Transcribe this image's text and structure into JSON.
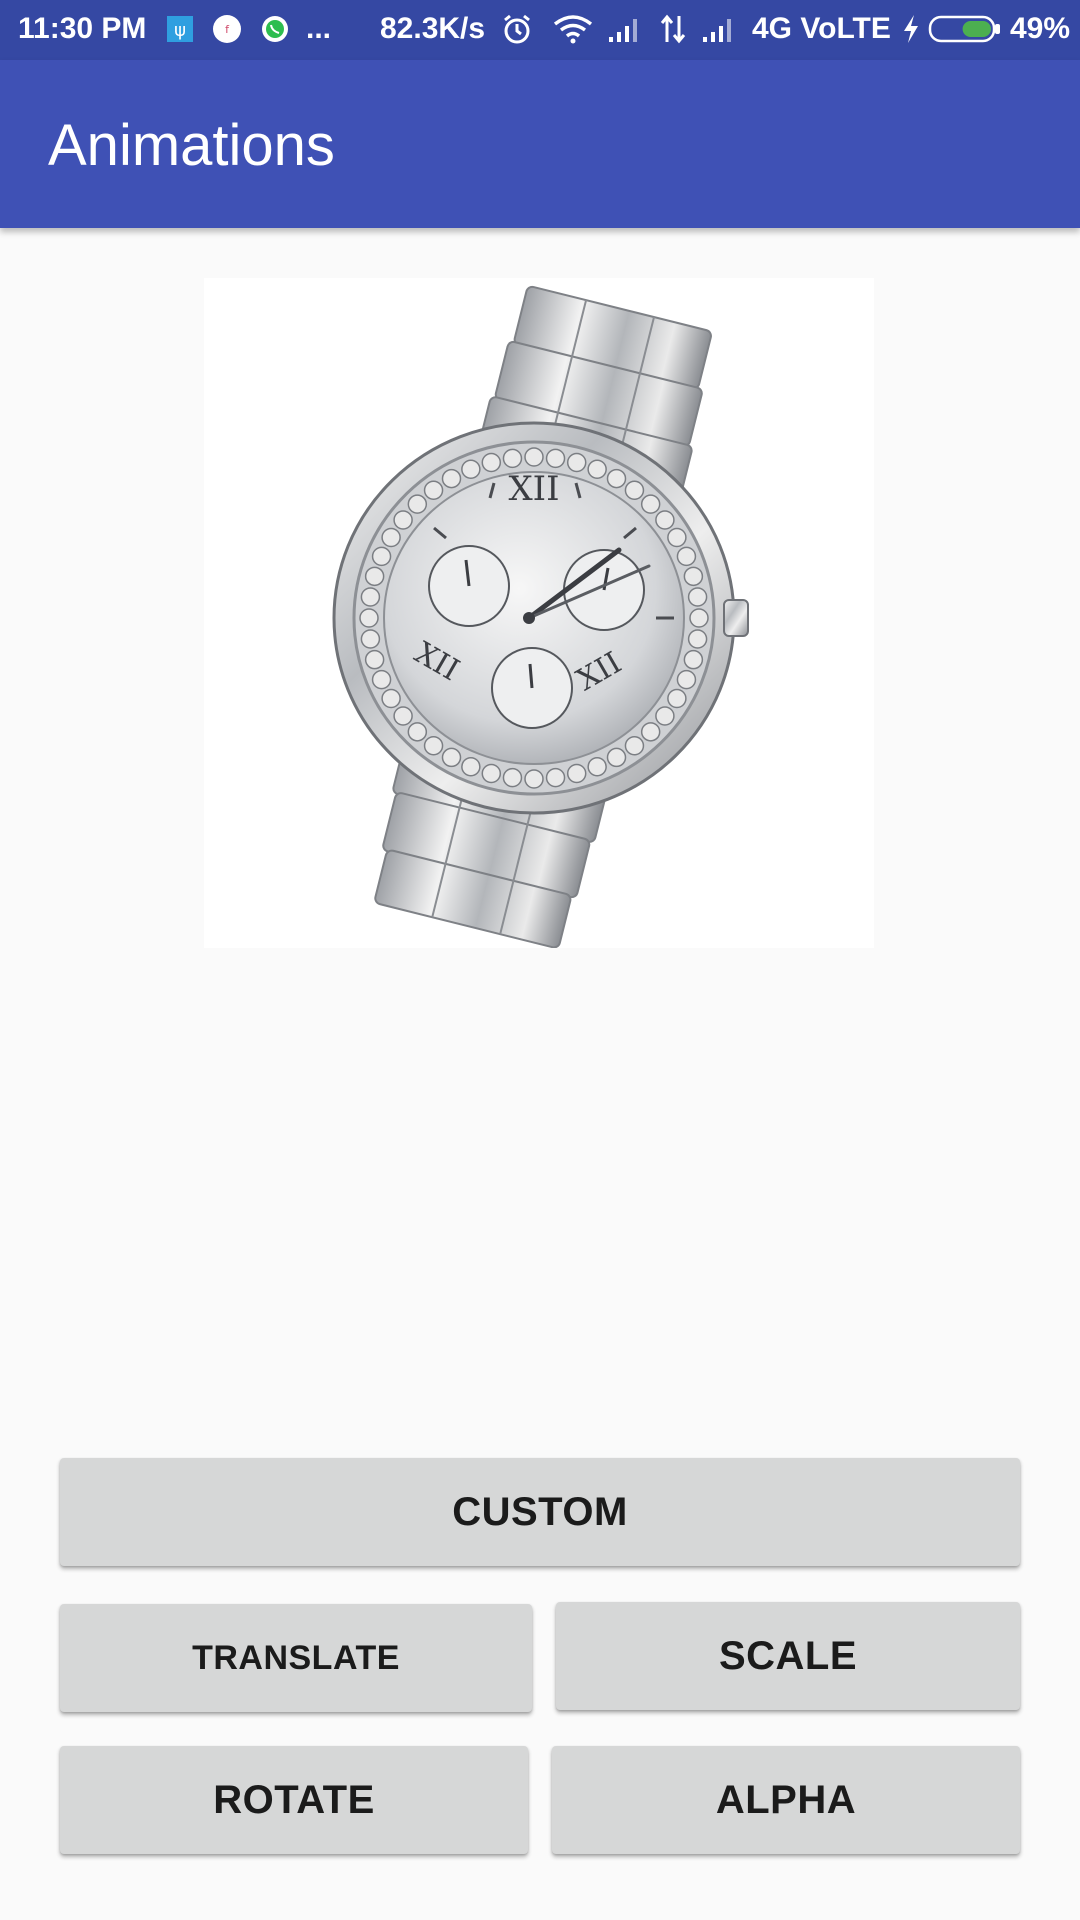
{
  "status_bar": {
    "time": "11:30 PM",
    "net_speed": "82.3K/s",
    "network": "4G VoLTE",
    "battery": "49%",
    "more": "...",
    "icons": [
      "usb-icon",
      "facebook-notification-icon",
      "whatsapp-icon",
      "alarm-icon",
      "wifi-icon",
      "signal-icon",
      "data-arrows-icon",
      "signal-icon",
      "charging-icon",
      "battery-icon"
    ],
    "battery_level": 0.49,
    "battery_color": "#4caf50"
  },
  "app_bar": {
    "title": "Animations",
    "color": "#3f51b5"
  },
  "image": {
    "subject": "wristwatch-image"
  },
  "buttons": {
    "custom": "CUSTOM",
    "translate": "TRANSLATE",
    "scale": "SCALE",
    "rotate": "ROTATE",
    "alpha": "ALPHA"
  }
}
